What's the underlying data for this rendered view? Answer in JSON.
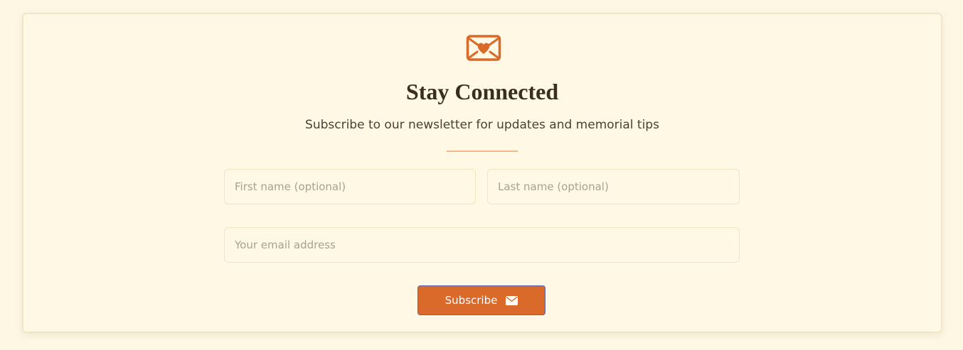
{
  "newsletter": {
    "icon": "envelope-heart-icon",
    "title": "Stay Connected",
    "subtitle": "Subscribe to our newsletter for updates and memorial tips",
    "first_name_placeholder": "First name (optional)",
    "last_name_placeholder": "Last name (optional)",
    "email_placeholder": "Your email address",
    "first_name_value": "",
    "last_name_value": "",
    "email_value": "",
    "subscribe_label": "Subscribe",
    "subscribe_icon": "envelope-icon"
  },
  "colors": {
    "page_background": "#fdf7e4",
    "card_background": "#fef8e5",
    "accent": "#d96a2a",
    "divider": "#efba86",
    "title": "#3a2e1c"
  }
}
